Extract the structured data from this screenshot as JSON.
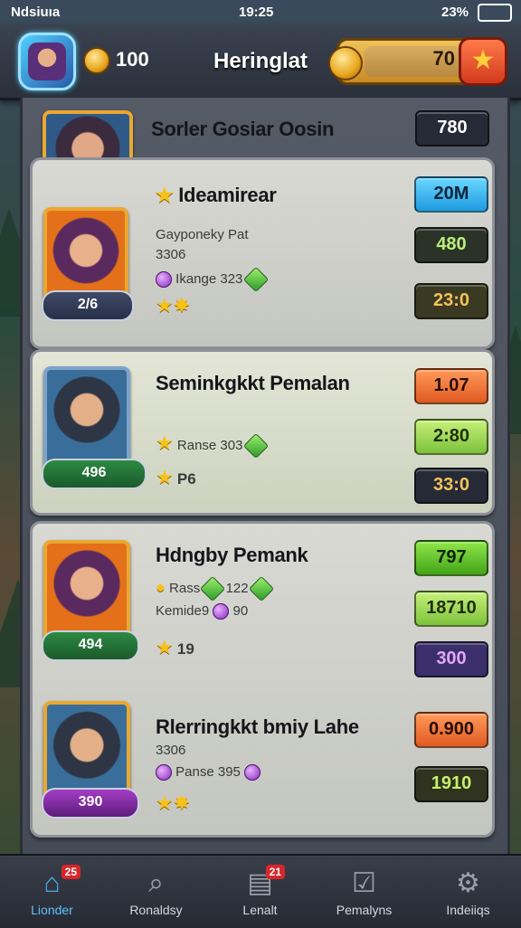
{
  "status": {
    "carrier": "Ndsiuıa",
    "time": "19:25",
    "battery": "23%"
  },
  "header": {
    "coins": "100",
    "title": "Heringlat",
    "gold": "70"
  },
  "top_entry": {
    "name": "Sorler Gosiar Oosin",
    "value": "780"
  },
  "cards": [
    {
      "name": "Ideamirear",
      "line1": "Gayponeky Pat",
      "line2": "3306",
      "gem_text": "Ikange 323",
      "level": "2/6",
      "values": [
        "20M",
        "480",
        "23:0"
      ]
    },
    {
      "name": "Seminkgkkt Pemalan",
      "gem_text": "Ranse 303",
      "stars_text": "P6",
      "level": "496",
      "values": [
        "1.07",
        "2:80",
        "33:0"
      ]
    },
    {
      "name": "Hdngby Pemank",
      "line1": "Rass",
      "line1b": "122",
      "line2": "Kemide9",
      "line2b": "90",
      "stars_text": "19",
      "level": "494",
      "values": [
        "797",
        "18710",
        "300"
      ]
    },
    {
      "name": "Rlerringkkt bmiy Lahe",
      "line1": "3306",
      "gem_text": "Panse 395",
      "level": "390",
      "values": [
        "0.900",
        "1910"
      ]
    }
  ],
  "tabs": [
    {
      "label": "Lionder",
      "badge": "25",
      "icon": "home-icon"
    },
    {
      "label": "Ronaldsy",
      "icon": "search-icon"
    },
    {
      "label": "Lenalt",
      "badge": "21",
      "icon": "inbox-icon"
    },
    {
      "label": "Pemalyns",
      "icon": "checkbox-icon"
    },
    {
      "label": "Indeiiqs",
      "icon": "settings-icon"
    }
  ],
  "colors": {
    "accent_blue": "#4aaee8",
    "gold": "#e8a51a",
    "badge_red": "#d8262a"
  }
}
